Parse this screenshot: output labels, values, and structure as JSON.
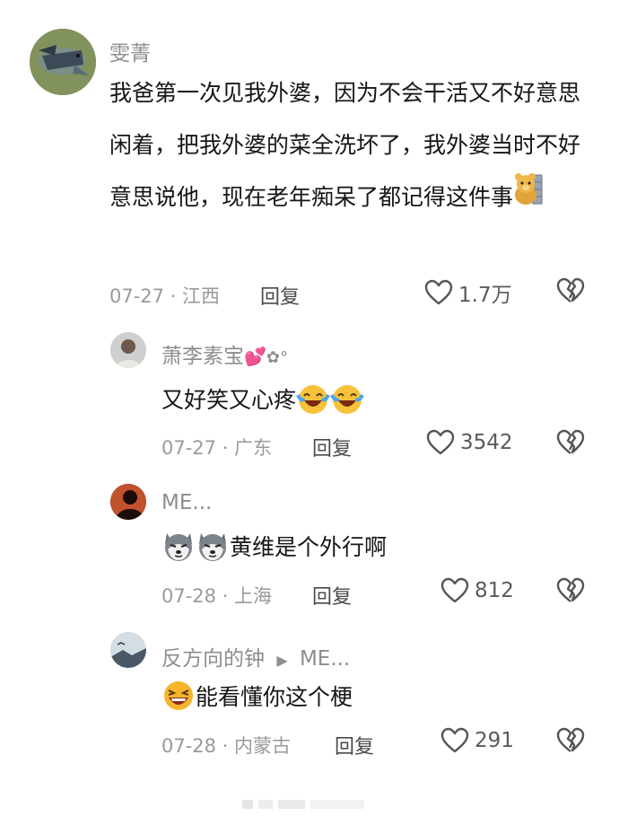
{
  "comments": [
    {
      "username": "雯菁",
      "text": "我爸第一次见我外婆，因为不会干活又不好意思闲着，把我外婆的菜全洗坏了，我外婆当时不好意思说他，现在老年痴呆了都记得这件事",
      "date_location": "07-27 · 江西",
      "reply_label": "回复",
      "likes": "1.7万"
    },
    {
      "username": "萧李素宝",
      "text": "又好笑又心疼",
      "date_location": "07-27 · 广东",
      "reply_label": "回复",
      "likes": "3542"
    },
    {
      "username": "ME...",
      "text": "黄维是个外行啊",
      "date_location": "07-28 · 上海",
      "reply_label": "回复",
      "likes": "812"
    },
    {
      "username": "反方向的钟",
      "reply_to": "ME...",
      "text": "能看懂你这个梗",
      "date_location": "07-28 · 内蒙古",
      "reply_label": "回复",
      "likes": "291"
    }
  ]
}
